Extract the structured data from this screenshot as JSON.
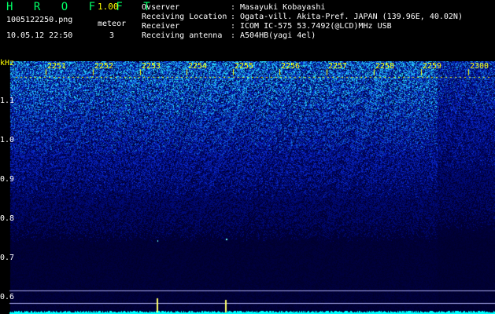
{
  "header": {
    "app_title": "H R O F F T",
    "version": "1.00",
    "filename": "1005122250.png",
    "datetime": "10.05.12 22:50",
    "meteor_label": "meteor",
    "meteor_count": "3"
  },
  "station": [
    {
      "key": "Ovserver",
      "value": "Masayuki Kobayashi"
    },
    {
      "key": "Receiving Location",
      "value": "Ogata-vill. Akita-Pref. JAPAN (139.96E, 40.02N)"
    },
    {
      "key": "Receiver",
      "value": "ICOM IC-575 53.7492(@LCD)MHz USB"
    },
    {
      "key": "Receiving antenna",
      "value": "A504HB(yagi 4el)"
    }
  ],
  "spectrogram": {
    "freq_unit": "kHz",
    "freq_labels": [
      "1.1",
      "1.0",
      "0.9",
      "0.8",
      "0.7",
      "0.6"
    ],
    "minute_labels": [
      "2251",
      "2252",
      "2253",
      "2254",
      "2255",
      "2256",
      "2257",
      "2258",
      "2259",
      "2300"
    ],
    "colors": {
      "axis_text": "#ffff00",
      "noise_high": "#00ffff",
      "noise_low": "#0000aa",
      "line": "#ccccff"
    }
  }
}
